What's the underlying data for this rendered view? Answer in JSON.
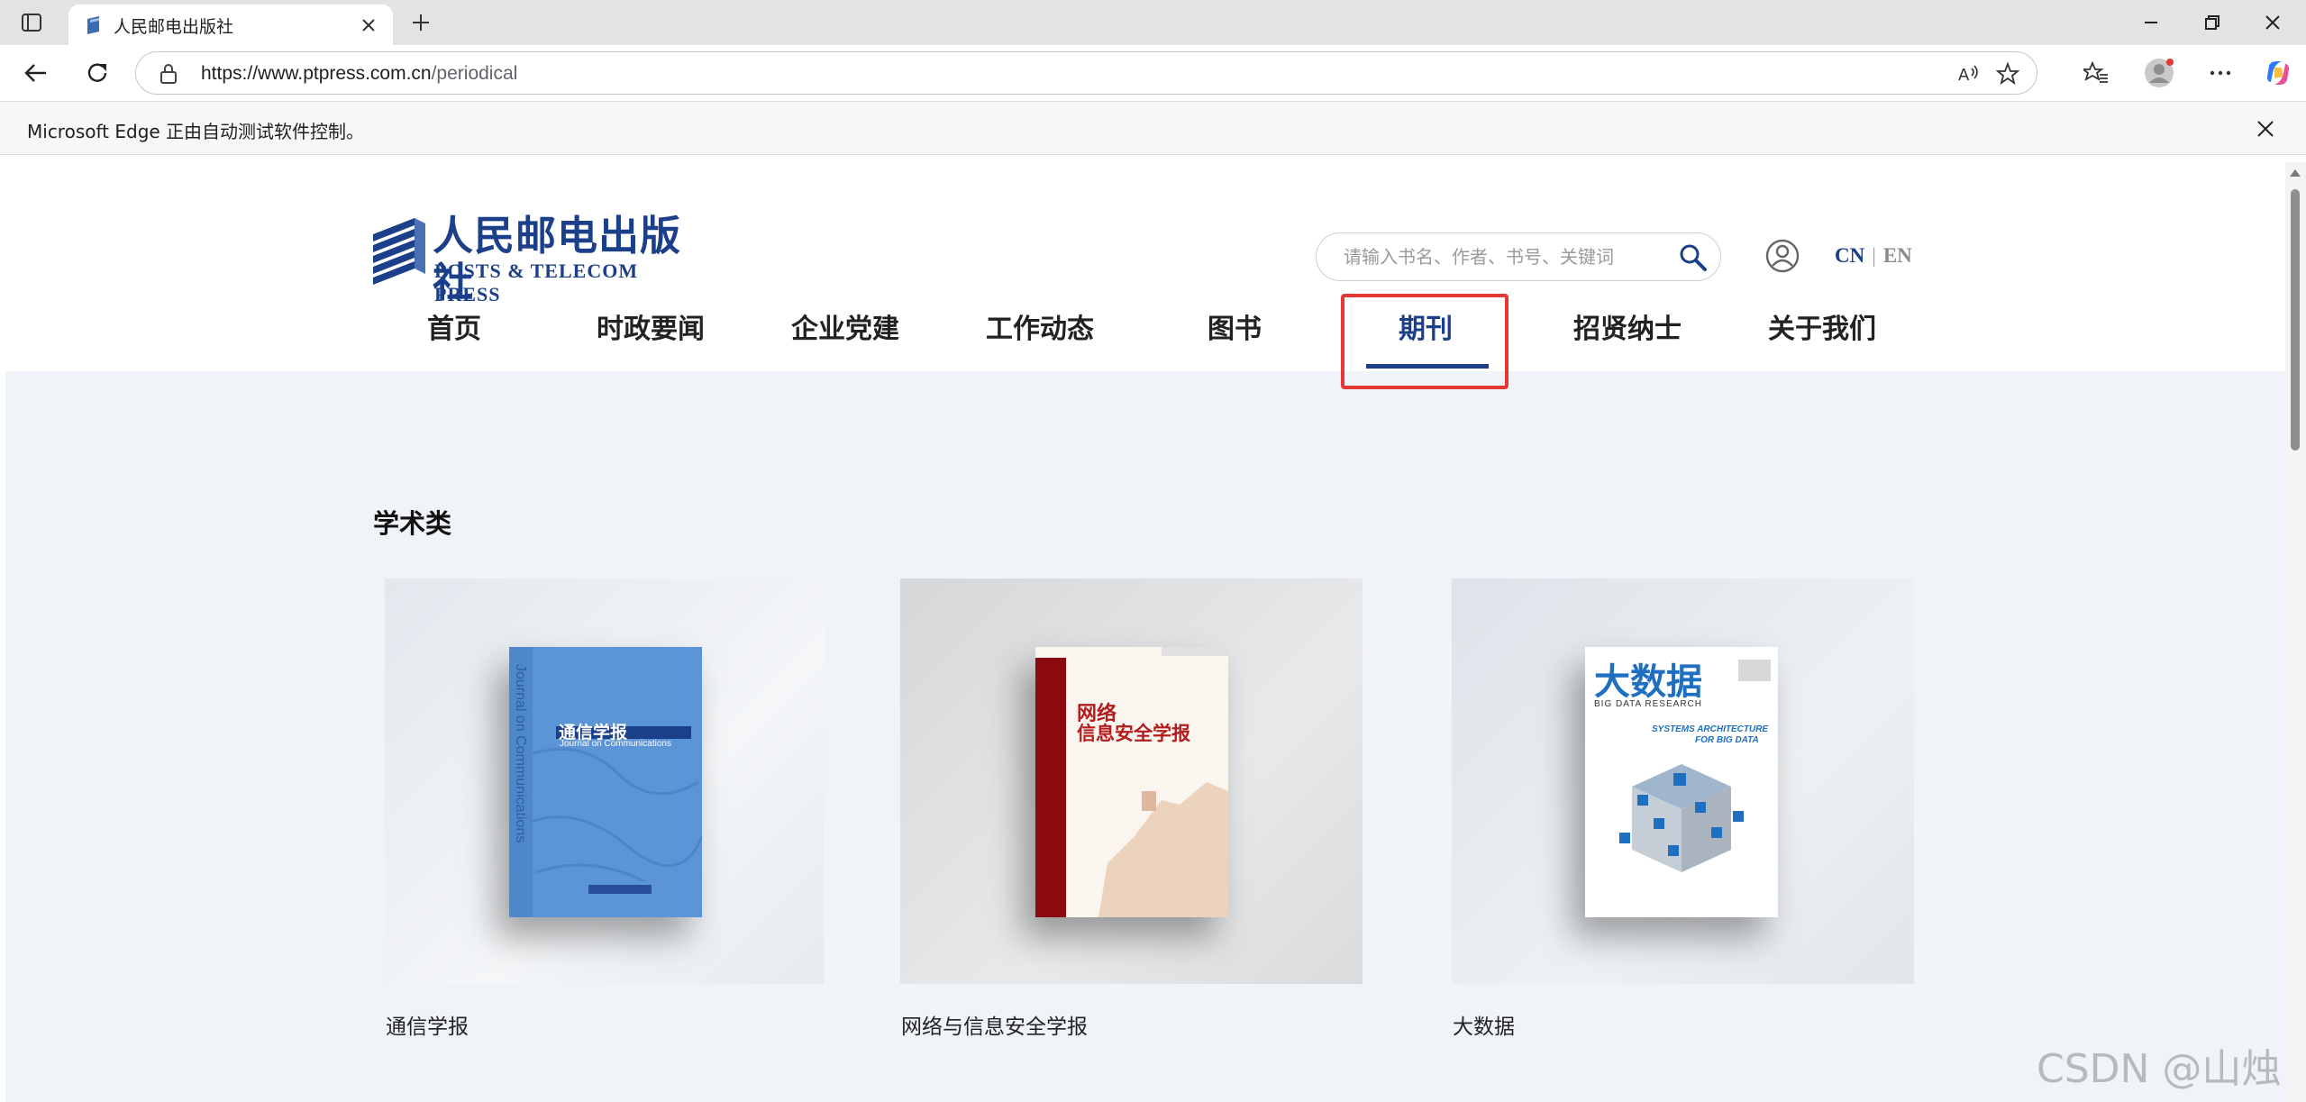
{
  "browser": {
    "tab_title": "人民邮电出版社",
    "url_host": "https://www.ptpress.com.cn",
    "url_path": "/periodical",
    "infobar_text": "Microsoft Edge 正由自动测试软件控制。"
  },
  "site": {
    "logo_cn": "人民邮电出版社",
    "logo_en": "POSTS & TELECOM PRESS",
    "search_placeholder": "请输入书名、作者、书号、关键词",
    "lang_cn": "CN",
    "lang_sep": "|",
    "lang_en": "EN",
    "nav": [
      {
        "label": "首页"
      },
      {
        "label": "时政要闻"
      },
      {
        "label": "企业党建"
      },
      {
        "label": "工作动态"
      },
      {
        "label": "图书"
      },
      {
        "label": "期刊"
      },
      {
        "label": "招贤纳士"
      },
      {
        "label": "关于我们"
      }
    ],
    "active_nav": "期刊",
    "accent_color": "#1c3f8a",
    "highlight_color": "#e53935"
  },
  "main": {
    "section_title": "学术类",
    "journals": [
      {
        "name": "通信学报",
        "cover_title": "通信学报",
        "cover_subtitle": "Journal on Communications",
        "cover_spine": "Journal on Communications",
        "cover_color": "#5b95d6"
      },
      {
        "name": "网络与信息安全学报",
        "cover_title_line1": "网络",
        "cover_title_line2": "信息安全学报",
        "cover_color": "#8b0a10"
      },
      {
        "name": "大数据",
        "cover_title": "大数据",
        "cover_subtitle": "BIG DATA RESEARCH",
        "cover_tagline1": "SYSTEMS ARCHITECTURE",
        "cover_tagline2": "FOR BIG DATA",
        "cover_color": "#1e6fc0"
      }
    ]
  },
  "watermark": "CSDN @山烛"
}
